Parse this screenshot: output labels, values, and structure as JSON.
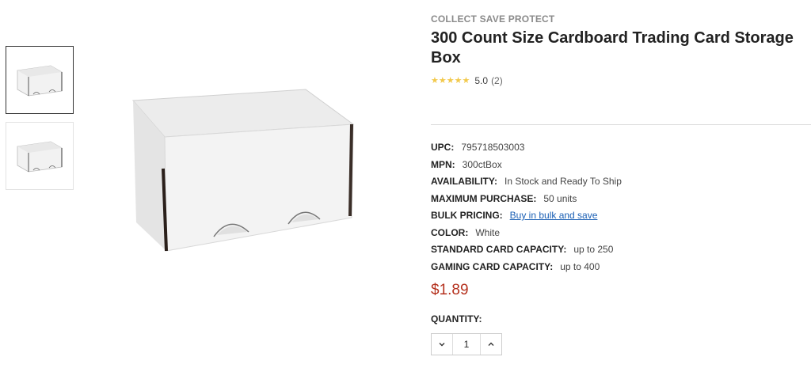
{
  "gallery": {
    "thumbnails": [
      {
        "icon": "storage-box-thumbnail",
        "active": true
      },
      {
        "icon": "storage-box-thumbnail",
        "active": false
      }
    ],
    "main_image_icon": "storage-box-image"
  },
  "product": {
    "brand": "COLLECT SAVE PROTECT",
    "title": "300 Count Size Cardboard Trading Card Storage Box",
    "rating": {
      "score": "5.0",
      "count": "(2)",
      "stars": 5
    },
    "specs": [
      {
        "label": "UPC:",
        "value": "795718503003"
      },
      {
        "label": "MPN:",
        "value": "300ctBox"
      },
      {
        "label": "AVAILABILITY:",
        "value": "In Stock and Ready To Ship"
      },
      {
        "label": "MAXIMUM PURCHASE:",
        "value": "50 units"
      },
      {
        "label": "BULK PRICING:",
        "value": "Buy in bulk and save"
      },
      {
        "label": "COLOR:",
        "value": "White"
      },
      {
        "label": "STANDARD CARD CAPACITY:",
        "value": "up to 250"
      },
      {
        "label": "GAMING CARD CAPACITY:",
        "value": "up to 400"
      }
    ],
    "price": "$1.89",
    "quantity": {
      "label": "QUANTITY:",
      "value": "1"
    }
  },
  "colors": {
    "price": "#b5321f",
    "link": "#1a5fb4",
    "star": "#f2c94c"
  }
}
